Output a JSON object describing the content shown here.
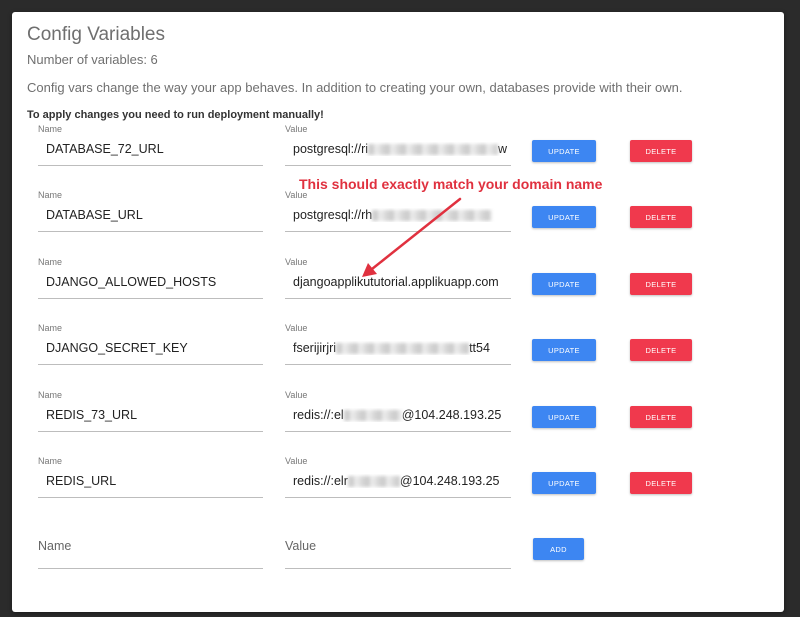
{
  "page": {
    "title": "Config Variables",
    "count": "Number of variables: 6",
    "description": "Config vars change the way your app behaves. In addition to creating your own, databases provide with their own.",
    "warning": "To apply changes you need to run deployment manually!"
  },
  "labels": {
    "name": "Name",
    "value": "Value",
    "update": "UPDATE",
    "delete": "DELETE"
  },
  "variables": [
    {
      "name": "DATABASE_72_URL",
      "value_start": "postgresql://ri",
      "value_end": "w",
      "redacted": true
    },
    {
      "name": "DATABASE_URL",
      "value_start": "postgresql://rh",
      "value_end": "",
      "redacted": true
    },
    {
      "name": "DJANGO_ALLOWED_HOSTS",
      "value_start": "djangoapplikututorial.applikuapp.com",
      "value_end": "",
      "redacted": false
    },
    {
      "name": "DJANGO_SECRET_KEY",
      "value_start": "fserijirjri",
      "value_end": "tt54",
      "redacted": true
    },
    {
      "name": "REDIS_73_URL",
      "value_start": "redis://:el",
      "value_end": "@104.248.193.25",
      "redacted": true
    },
    {
      "name": "REDIS_URL",
      "value_start": "redis://:elr",
      "value_end": "@104.248.193.25",
      "redacted": true
    }
  ],
  "new_var": {
    "name_placeholder": "Name",
    "value_placeholder": "Value",
    "add": "ADD"
  },
  "annotation": {
    "text": "This should exactly match your domain name",
    "color": "#e0313f"
  },
  "colors": {
    "update": "#3d86f2",
    "delete": "#f0394d"
  }
}
